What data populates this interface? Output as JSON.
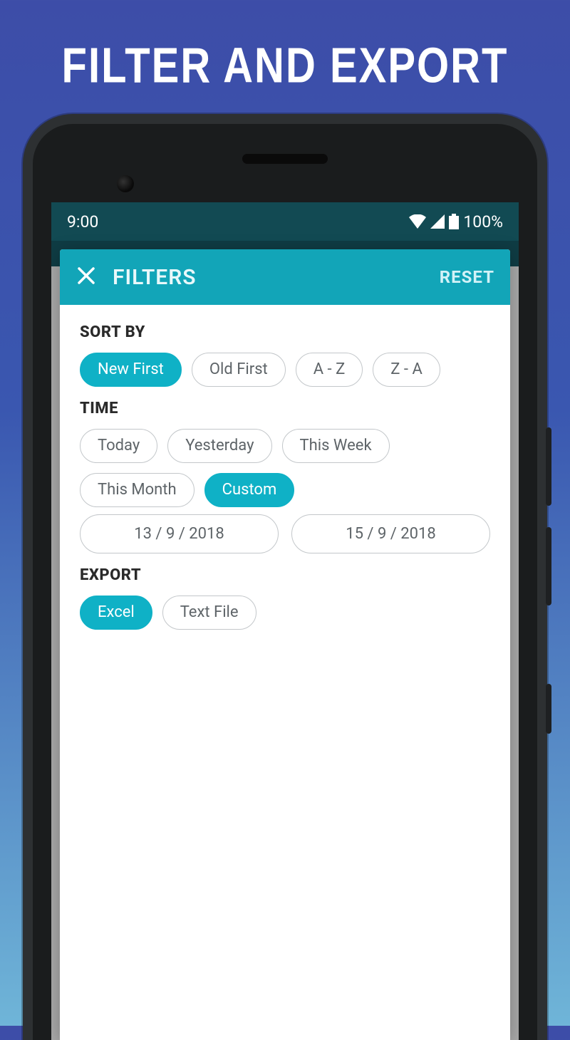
{
  "promo": {
    "title": "FILTER AND EXPORT"
  },
  "status": {
    "time": "9:00",
    "battery": "100%"
  },
  "sheet": {
    "title": "FILTERS",
    "reset": "RESET"
  },
  "sections": {
    "sort": {
      "label": "SORT BY",
      "options": [
        "New First",
        "Old First",
        "A - Z",
        "Z - A"
      ],
      "selected": 0
    },
    "time": {
      "label": "TIME",
      "options": [
        "Today",
        "Yesterday",
        "This Week",
        "This Month",
        "Custom"
      ],
      "selected": 4,
      "date_from": "13 / 9 / 2018",
      "date_to": "15 / 9 / 2018"
    },
    "export": {
      "label": "EXPORT",
      "options": [
        "Excel",
        "Text File"
      ],
      "selected": 0
    }
  }
}
